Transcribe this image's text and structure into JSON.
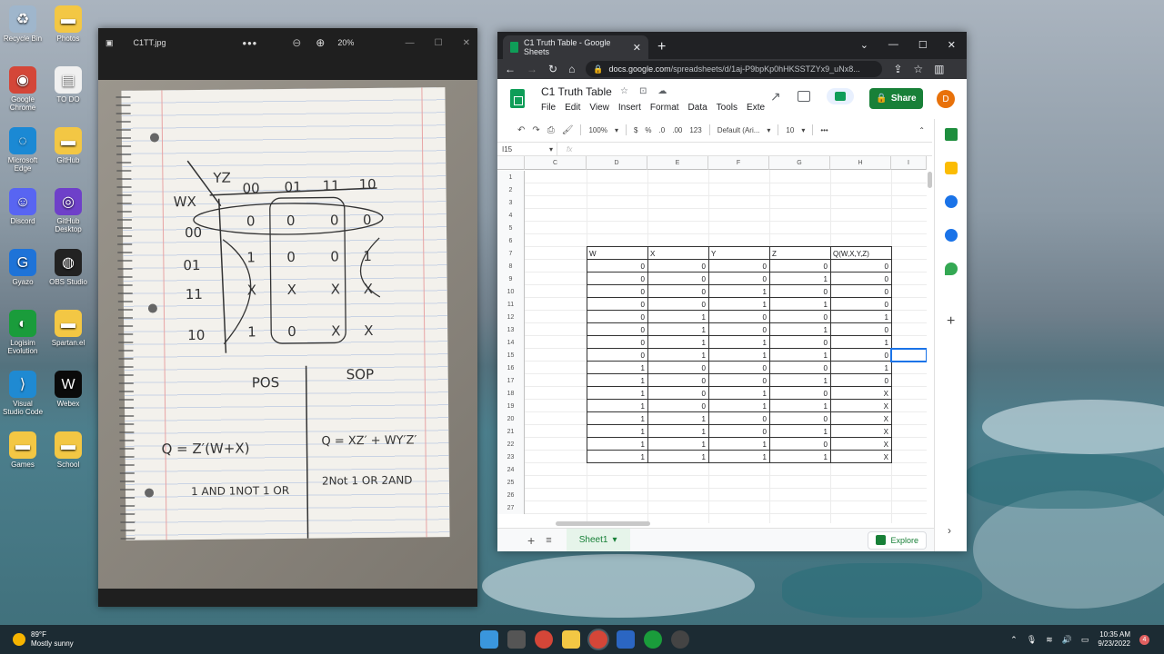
{
  "desktop": {
    "icons": [
      {
        "label": "Recycle Bin",
        "color": "#9fb6cc",
        "glyph": "♻"
      },
      {
        "label": "Photos",
        "color": "#f3c744",
        "glyph": "▬"
      },
      {
        "label": "Google Chrome",
        "color": "#d44638",
        "glyph": "◉"
      },
      {
        "label": "TO DO",
        "color": "#f0f0f0",
        "glyph": "▤"
      },
      {
        "label": "Microsoft Edge",
        "color": "#1b89d4",
        "glyph": "◌"
      },
      {
        "label": "GitHub",
        "color": "#f3c744",
        "glyph": "▬"
      },
      {
        "label": "Discord",
        "color": "#5865f2",
        "glyph": "☺"
      },
      {
        "label": "GitHub Desktop",
        "color": "#6e40c9",
        "glyph": "◎"
      },
      {
        "label": "Gyazo",
        "color": "#1e73d8",
        "glyph": "G"
      },
      {
        "label": "OBS Studio",
        "color": "#222",
        "glyph": "◍"
      },
      {
        "label": "Logisim Evolution",
        "color": "#1a9c3b",
        "glyph": "◐"
      },
      {
        "label": "Spartan.el",
        "color": "#f3c744",
        "glyph": "▬"
      },
      {
        "label": "Visual Studio Code",
        "color": "#1f8ad2",
        "glyph": "⟩"
      },
      {
        "label": "Webex",
        "color": "#0a0a0a",
        "glyph": "W"
      },
      {
        "label": "Games",
        "color": "#f3c744",
        "glyph": "▬"
      },
      {
        "label": "School",
        "color": "#f3c744",
        "glyph": "▬"
      }
    ]
  },
  "photos_app": {
    "title": "C1TT.jpg",
    "zoom": "20%",
    "more": "•••",
    "handwriting": {
      "corner_yz": "YZ",
      "corner_wx": "WX",
      "col_headers": [
        "00",
        "01",
        "11",
        "10"
      ],
      "row_headers": [
        "00",
        "01",
        "11",
        "10"
      ],
      "cells": [
        [
          "0",
          "0",
          "0",
          "0"
        ],
        [
          "1",
          "0",
          "0",
          "1"
        ],
        [
          "X",
          "X",
          "X",
          "X"
        ],
        [
          "1",
          "0",
          "X",
          "X"
        ]
      ],
      "pos_label": "POS",
      "sop_label": "SOP",
      "pos_expr": "Q = Z′(W+X)",
      "sop_expr": "Q = XZ′ + WY′Z′",
      "pos_note": "1 AND 1NOT 1 OR",
      "sop_note": "2Not 1 OR 2AND"
    }
  },
  "browser": {
    "tab_title": "C1 Truth Table - Google Sheets",
    "url_host": "docs.google.com",
    "url_path": "/spreadsheets/d/1aj-P9bpKp0hHKSSTZYx9_uNx8...",
    "new_tab": "+",
    "tab_close": "✕"
  },
  "sheets": {
    "doc_title": "C1 Truth Table",
    "menus": [
      "File",
      "Edit",
      "View",
      "Insert",
      "Format",
      "Data",
      "Tools",
      "Exte"
    ],
    "share_label": "Share",
    "avatar_letter": "D",
    "toolbar": {
      "zoom": "100%",
      "currency": "$",
      "percent": "%",
      "dec_less": ".0",
      "dec_more": ".00",
      "number_format": "123",
      "font": "Default (Ari...",
      "font_size": "10"
    },
    "name_box": "I15",
    "fx": "fx",
    "col_letters": [
      "C",
      "D",
      "E",
      "F",
      "G",
      "H",
      "I"
    ],
    "row_numbers": [
      "1",
      "2",
      "3",
      "4",
      "5",
      "6",
      "7",
      "8",
      "9",
      "10",
      "11",
      "12",
      "13",
      "14",
      "15",
      "16",
      "17",
      "18",
      "19",
      "20",
      "21",
      "22",
      "23",
      "24",
      "25",
      "26",
      "27"
    ],
    "table_headers": [
      "W",
      "X",
      "Y",
      "Z",
      "Q(W,X,Y,Z)"
    ],
    "table_rows": [
      [
        "0",
        "0",
        "0",
        "0",
        "0"
      ],
      [
        "0",
        "0",
        "0",
        "1",
        "0"
      ],
      [
        "0",
        "0",
        "1",
        "0",
        "0"
      ],
      [
        "0",
        "0",
        "1",
        "1",
        "0"
      ],
      [
        "0",
        "1",
        "0",
        "0",
        "1"
      ],
      [
        "0",
        "1",
        "0",
        "1",
        "0"
      ],
      [
        "0",
        "1",
        "1",
        "0",
        "1"
      ],
      [
        "0",
        "1",
        "1",
        "1",
        "0"
      ],
      [
        "1",
        "0",
        "0",
        "0",
        "1"
      ],
      [
        "1",
        "0",
        "0",
        "1",
        "0"
      ],
      [
        "1",
        "0",
        "1",
        "0",
        "X"
      ],
      [
        "1",
        "0",
        "1",
        "1",
        "X"
      ],
      [
        "1",
        "1",
        "0",
        "0",
        "X"
      ],
      [
        "1",
        "1",
        "0",
        "1",
        "X"
      ],
      [
        "1",
        "1",
        "1",
        "0",
        "X"
      ],
      [
        "1",
        "1",
        "1",
        "1",
        "X"
      ]
    ],
    "sheet_tab": "Sheet1",
    "explore_label": "Explore"
  },
  "taskbar": {
    "temp": "89°F",
    "weather": "Mostly sunny",
    "time": "10:35 AM",
    "date": "9/23/2022",
    "notifications": "4"
  }
}
